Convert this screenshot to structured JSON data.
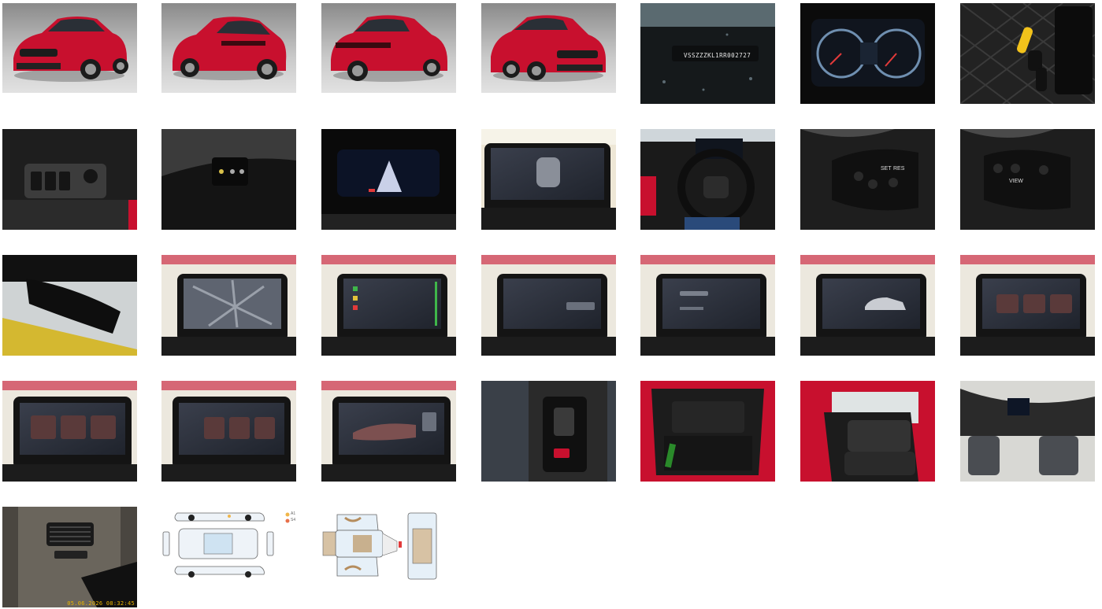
{
  "gallery": {
    "vin_text": "VSSZZZKL1RR002727",
    "photo_timestamp": "05.06.2026 08:32:45",
    "damage_legend": [
      "A1",
      "S4"
    ],
    "colors": {
      "car_red": "#c8102e",
      "legend_yellow": "#f0b64a",
      "legend_orange": "#e8704a"
    }
  }
}
